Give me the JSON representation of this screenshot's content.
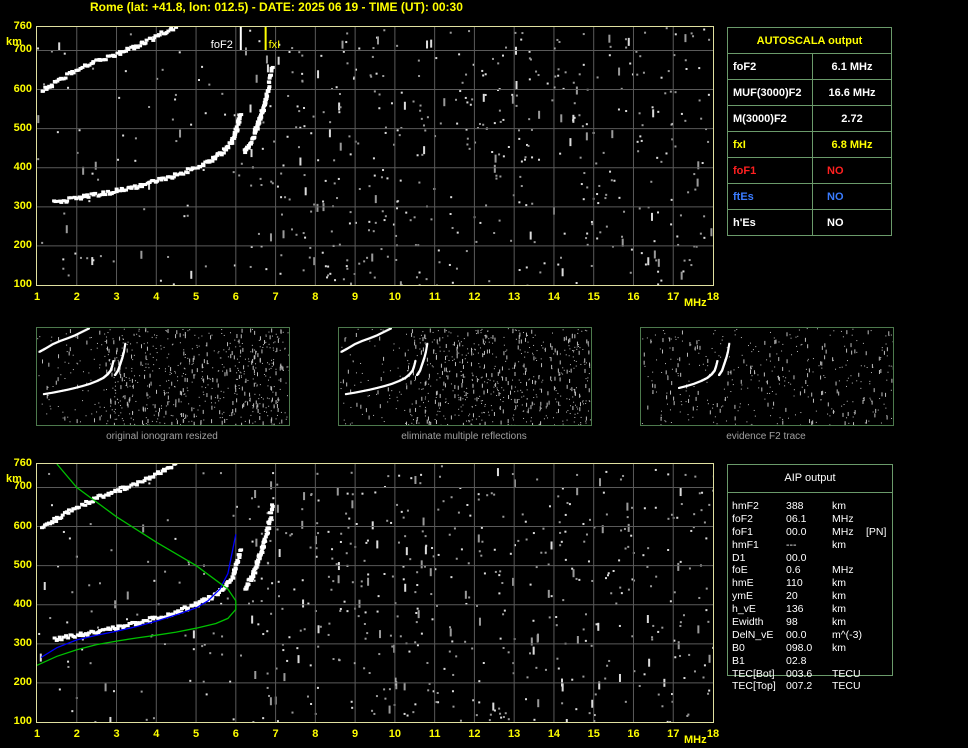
{
  "header": {
    "title": "Rome (lat: +41.8, lon: 012.5) - DATE: 2025 06 19 - TIME (UT): 00:30"
  },
  "colors": {
    "grid": "#5a5a5a",
    "frame": "#e0e0a0",
    "label": "#ffff00",
    "trace": "#ffffff",
    "aip_profile": "#0000ff",
    "model_profile": "#00c000"
  },
  "axes": {
    "x_ticks": [
      "1",
      "2",
      "3",
      "4",
      "5",
      "6",
      "7",
      "8",
      "9",
      "10",
      "11",
      "12",
      "13",
      "14",
      "15",
      "16",
      "17",
      "18"
    ],
    "y_ticks": [
      "100",
      "200",
      "300",
      "400",
      "500",
      "600",
      "700",
      "760"
    ],
    "x_unit": "MHz",
    "y_unit": "km"
  },
  "markers": {
    "fof2_label": "foF2",
    "fxi_label": "fxI"
  },
  "thumbnails": [
    {
      "caption": "original ionogram resized"
    },
    {
      "caption": "eliminate multiple reflections"
    },
    {
      "caption": "evidence F2 trace"
    }
  ],
  "autoscala": {
    "title": "AUTOSCALA output",
    "rows": [
      {
        "label": "foF2",
        "value": "6.1 MHz",
        "color": "#ffffff"
      },
      {
        "label": "MUF(3000)F2",
        "value": "16.6 MHz",
        "color": "#ffffff"
      },
      {
        "label": "M(3000)F2",
        "value": "2.72",
        "color": "#ffffff"
      },
      {
        "label": "fxI",
        "value": "6.8 MHz",
        "color": "#ffff00"
      },
      {
        "label": "foF1",
        "value": "NO",
        "color": "#ff2020"
      },
      {
        "label": "ftEs",
        "value": "NO",
        "color": "#3a7cff"
      },
      {
        "label": "h'Es",
        "value": "NO",
        "color": "#ffffff"
      }
    ]
  },
  "aip": {
    "title": "AIP output",
    "rows": [
      {
        "param": "hmF2",
        "value": "388",
        "unit": "km",
        "note": ""
      },
      {
        "param": "foF2",
        "value": "06.1",
        "unit": "MHz",
        "note": ""
      },
      {
        "param": "foF1",
        "value": "00.0",
        "unit": "MHz",
        "note": "[PN]"
      },
      {
        "param": "hmF1",
        "value": "---",
        "unit": "km",
        "note": ""
      },
      {
        "param": "D1",
        "value": "00.0",
        "unit": "",
        "note": ""
      },
      {
        "param": "foE",
        "value": "0.6",
        "unit": "MHz",
        "note": ""
      },
      {
        "param": "hmE",
        "value": "110",
        "unit": "km",
        "note": ""
      },
      {
        "param": "ymE",
        "value": "20",
        "unit": "km",
        "note": ""
      },
      {
        "param": "h_vE",
        "value": "136",
        "unit": "km",
        "note": ""
      },
      {
        "param": "Ewidth",
        "value": "98",
        "unit": "km",
        "note": ""
      },
      {
        "param": "DelN_vE",
        "value": "00.0",
        "unit": "m^(-3)",
        "note": ""
      },
      {
        "param": "B0",
        "value": "098.0",
        "unit": "km",
        "note": ""
      },
      {
        "param": "B1",
        "value": "02.8",
        "unit": "",
        "note": ""
      },
      {
        "param": "TEC[Bot]",
        "value": "003.6",
        "unit": "TECU",
        "note": ""
      },
      {
        "param": "TEC[Top]",
        "value": "007.2",
        "unit": "TECU",
        "note": ""
      }
    ]
  },
  "chart_data": [
    {
      "type": "scatter",
      "name": "autoscala-ionogram",
      "xlabel": "MHz",
      "ylabel": "km",
      "xlim": [
        1,
        18
      ],
      "ylim": [
        100,
        760
      ],
      "grid": true,
      "traces": [
        {
          "name": "F2 ordinary trace",
          "x": [
            1.4,
            2.0,
            2.5,
            3.0,
            3.5,
            4.0,
            4.5,
            5.0,
            5.4,
            5.7,
            5.9,
            6.0,
            6.1
          ],
          "y": [
            310,
            320,
            330,
            340,
            352,
            365,
            380,
            400,
            420,
            445,
            470,
            500,
            540
          ]
        },
        {
          "name": "F2 extraordinary trace",
          "x": [
            6.2,
            6.4,
            6.5,
            6.6,
            6.7,
            6.8,
            6.9
          ],
          "y": [
            440,
            470,
            500,
            530,
            560,
            600,
            660
          ]
        },
        {
          "name": "second-hop echo",
          "x": [
            1.1,
            1.5,
            2.0,
            2.5,
            3.0,
            3.5,
            4.0,
            4.5
          ],
          "y": [
            598,
            620,
            650,
            672,
            690,
            710,
            735,
            760
          ]
        }
      ],
      "markers": [
        {
          "name": "foF2",
          "x": 6.1
        },
        {
          "name": "fxI",
          "x": 6.8
        }
      ]
    },
    {
      "type": "line",
      "name": "aip-ionogram",
      "xlabel": "MHz",
      "ylabel": "km",
      "xlim": [
        1,
        18
      ],
      "ylim": [
        100,
        760
      ],
      "grid": true,
      "traces": [
        {
          "name": "F2 ordinary trace",
          "x": [
            1.4,
            2.0,
            2.5,
            3.0,
            3.5,
            4.0,
            4.5,
            5.0,
            5.4,
            5.7,
            5.9,
            6.0,
            6.1
          ],
          "y": [
            310,
            320,
            330,
            340,
            352,
            365,
            380,
            400,
            420,
            445,
            470,
            500,
            540
          ]
        },
        {
          "name": "F2 extraordinary trace",
          "x": [
            6.2,
            6.4,
            6.5,
            6.6,
            6.7,
            6.8,
            6.9
          ],
          "y": [
            440,
            470,
            500,
            530,
            560,
            600,
            660
          ]
        },
        {
          "name": "second-hop echo",
          "x": [
            1.1,
            1.5,
            2.0,
            2.5,
            3.0,
            3.5,
            4.0,
            4.5
          ],
          "y": [
            598,
            620,
            650,
            672,
            690,
            710,
            735,
            760
          ]
        }
      ],
      "series": [
        {
          "name": "synthetic trace",
          "color": "#0000ff",
          "x": [
            1.1,
            1.5,
            2.0,
            2.5,
            3.0,
            3.5,
            4.0,
            4.5,
            5.0,
            5.3,
            5.6,
            5.8,
            6.0
          ],
          "y": [
            265,
            290,
            310,
            322,
            332,
            344,
            358,
            374,
            392,
            410,
            440,
            480,
            580
          ]
        },
        {
          "name": "electron density profile",
          "color": "#00c000",
          "x": [
            1.0,
            1.5,
            2.0,
            2.5,
            3.0,
            3.5,
            4.0,
            4.5,
            5.0,
            5.5,
            5.8,
            6.0,
            6.0,
            5.8,
            5.0,
            4.0,
            3.0,
            2.0,
            1.5
          ],
          "y": [
            245,
            268,
            285,
            298,
            307,
            315,
            322,
            330,
            340,
            352,
            365,
            388,
            410,
            440,
            500,
            560,
            625,
            700,
            760
          ]
        }
      ]
    }
  ]
}
